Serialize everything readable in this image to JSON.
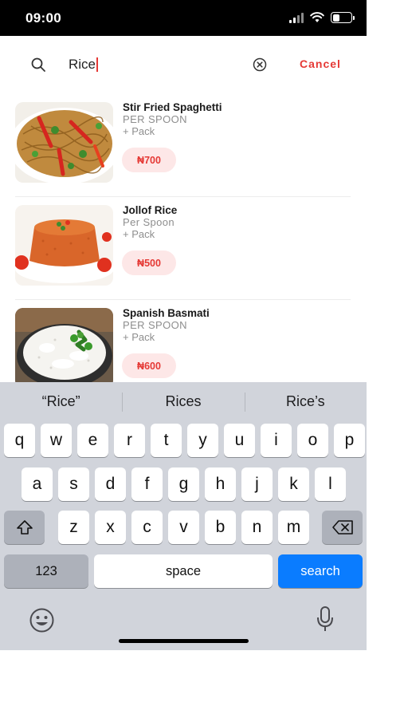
{
  "status_bar": {
    "time": "09:00"
  },
  "search": {
    "query": "Rice",
    "cancel_label": "Cancel"
  },
  "results": [
    {
      "name": "Stir Fried Spaghetti",
      "unit": "PER SPOON",
      "pack": "+ Pack",
      "price": "₦700"
    },
    {
      "name": "Jollof Rice",
      "unit": "Per Spoon",
      "pack": "+ Pack",
      "price": "₦500"
    },
    {
      "name": "Spanish Basmati",
      "unit": "PER SPOON",
      "pack": "+ Pack",
      "price": "₦600"
    }
  ],
  "keyboard": {
    "suggestions": [
      "“Rice”",
      "Rices",
      "Rice’s"
    ],
    "row1": [
      "q",
      "w",
      "e",
      "r",
      "t",
      "y",
      "u",
      "i",
      "o",
      "p"
    ],
    "row2": [
      "a",
      "s",
      "d",
      "f",
      "g",
      "h",
      "j",
      "k",
      "l"
    ],
    "row3": [
      "z",
      "x",
      "c",
      "v",
      "b",
      "n",
      "m"
    ],
    "numbers_label": "123",
    "space_label": "space",
    "search_label": "search"
  },
  "colors": {
    "accent": "#e53935",
    "price_bg": "#fde7e7",
    "keyboard_bg": "#d1d4db",
    "search_key": "#0a7cff"
  }
}
